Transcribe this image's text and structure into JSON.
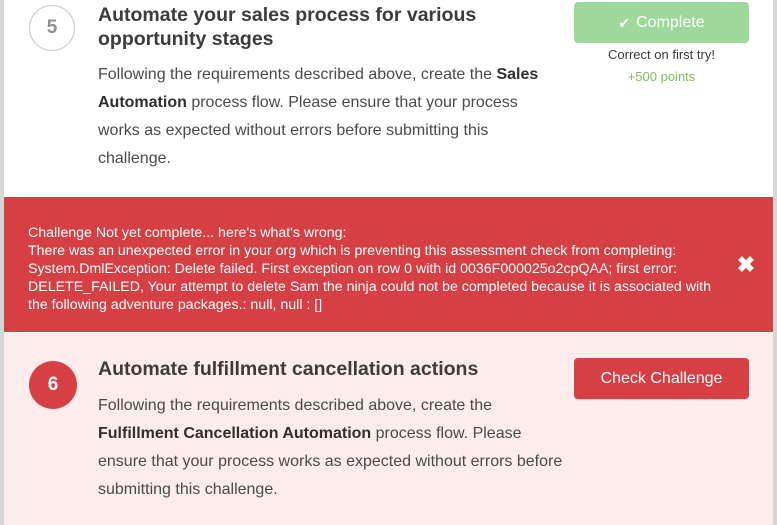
{
  "challenge5": {
    "step_number": "5",
    "title": "Automate your sales process for various opportunity stages",
    "desc_before": "Following the requirements described above, create the ",
    "desc_bold": "Sales Automation",
    "desc_after": " process flow. Please ensure that your process works as expected without errors before submitting this challenge.",
    "complete_label": "Complete",
    "complete_icon": "check-icon",
    "correct_text": "Correct on first try!",
    "points_text": "+500 points"
  },
  "error_banner": {
    "line1": "Challenge Not yet complete... here's what's wrong:",
    "line2": "There was an unexpected error in your org which is preventing this assessment check from completing: System.DmlException: Delete failed. First exception on row 0 with id 0036F000025o2cpQAA; first error: DELETE_FAILED, Your attempt to delete Sam the ninja could not be completed because it is associated with the following adventure packages.: null, null : []",
    "close_icon": "close-icon"
  },
  "challenge6": {
    "step_number": "6",
    "title": "Automate fulfillment cancellation actions",
    "desc_before": "Following the requirements described above, create the ",
    "desc_bold": "Fulfillment Cancellation Automation",
    "desc_after": " process flow. Please ensure that your process works as expected without errors before submitting this challenge.",
    "check_label": "Check Challenge"
  },
  "colors": {
    "error_red": "#d63f44",
    "complete_green": "#9ed89a",
    "points_green": "#7fbd54",
    "challenge6_bg": "#fdecec"
  }
}
